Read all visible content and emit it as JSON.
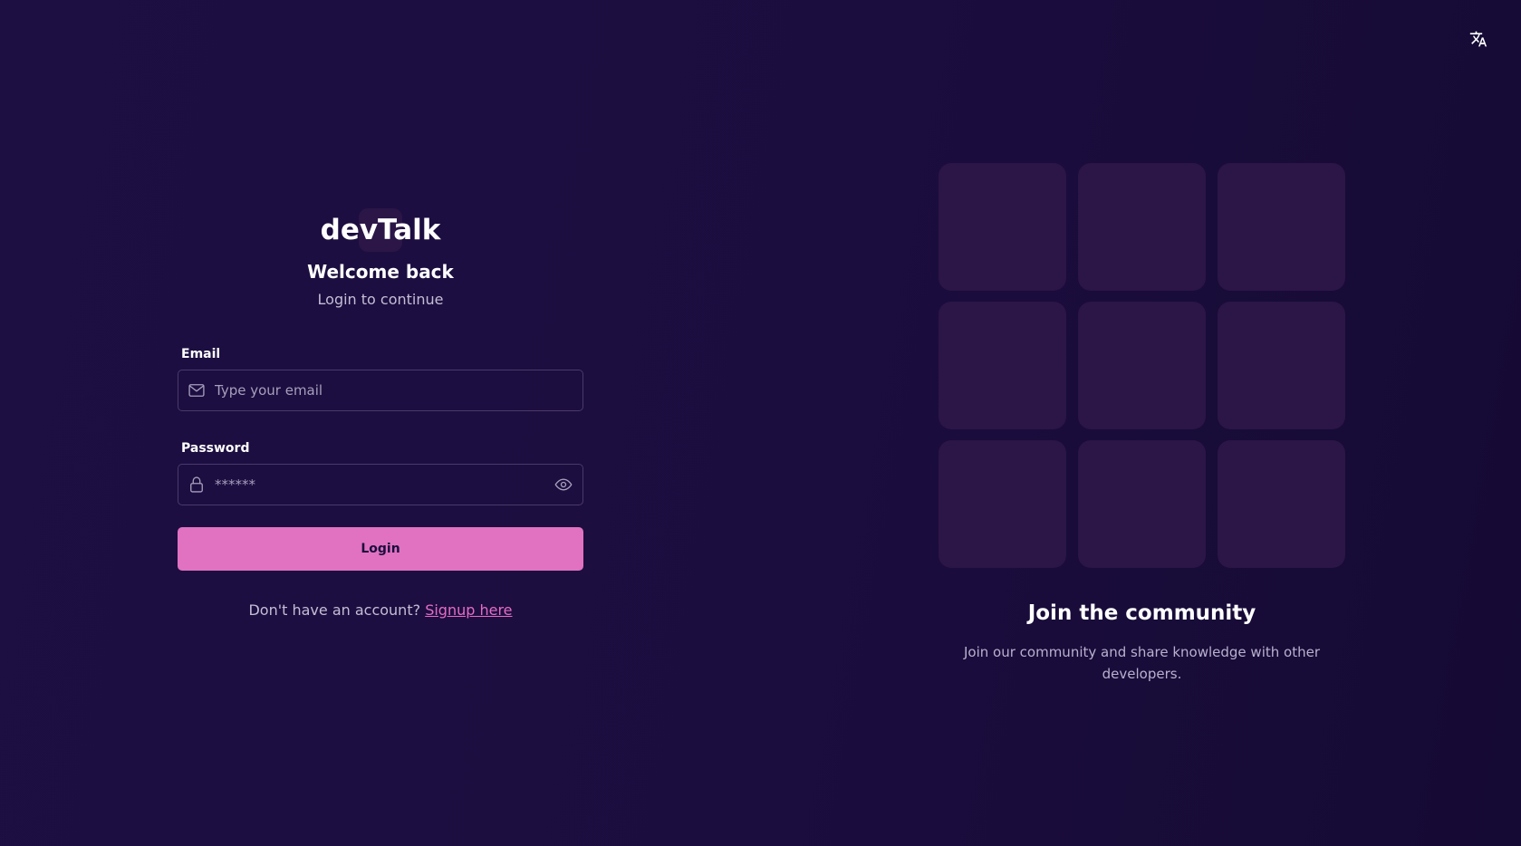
{
  "header": {
    "language_icon": "translate-icon"
  },
  "login": {
    "brand": "devTalk",
    "welcome": "Welcome back",
    "subtitle": "Login to continue",
    "email_label": "Email",
    "email_placeholder": "Type your email",
    "email_icon": "mail-icon",
    "password_label": "Password",
    "password_placeholder": "******",
    "password_icon": "lock-icon",
    "visibility_icon": "eye-icon",
    "submit_label": "Login",
    "signup_prompt": "Don't have an account?",
    "signup_link": "Signup here"
  },
  "community": {
    "title": "Join the community",
    "description": "Join our community and share knowledge with other developers.",
    "tile_count": 9
  },
  "colors": {
    "background": "#1b0d3e",
    "accent": "#e172c1",
    "link": "#e56cc5",
    "tile": "#2c1547"
  }
}
